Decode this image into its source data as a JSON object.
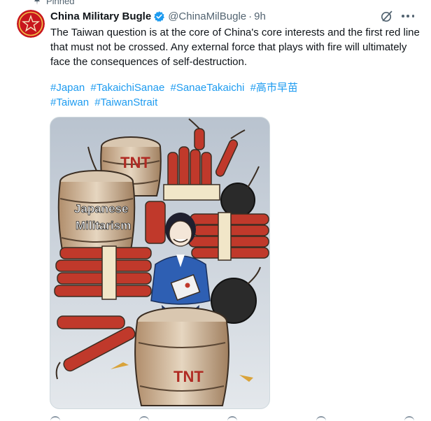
{
  "pinned": {
    "label": "Pinned"
  },
  "tweet": {
    "author_name": "China Military Bugle",
    "author_handle": "@ChinaMilBugle",
    "separator": "·",
    "time": "9h",
    "text": "The Taiwan question is at the core of China's core interests and the first red line that must not be crossed. Any external force that plays with fire will ultimately face the consequences of self-destruction.",
    "hashtags_line1": [
      "#Japan",
      "#TakaichiSanae",
      "#SanaeTakaichi",
      "#高市早苗"
    ],
    "hashtags_line2": [
      "#Taiwan",
      "#TaiwanStrait"
    ]
  },
  "media": {
    "labels": {
      "barrel_top": "TNT",
      "barrel_left_line1": "Japanese",
      "barrel_left_line2": "Militarism",
      "barrel_bottom": "TNT"
    }
  },
  "icons": {
    "pin": "pin-icon",
    "verified": "verified-badge-icon",
    "grok": "grok-icon",
    "more": "more-options-icon"
  },
  "colors": {
    "link": "#1d9bf0",
    "verified": "#1d9bf0",
    "muted": "#536471",
    "avatar_red": "#c8161d"
  }
}
